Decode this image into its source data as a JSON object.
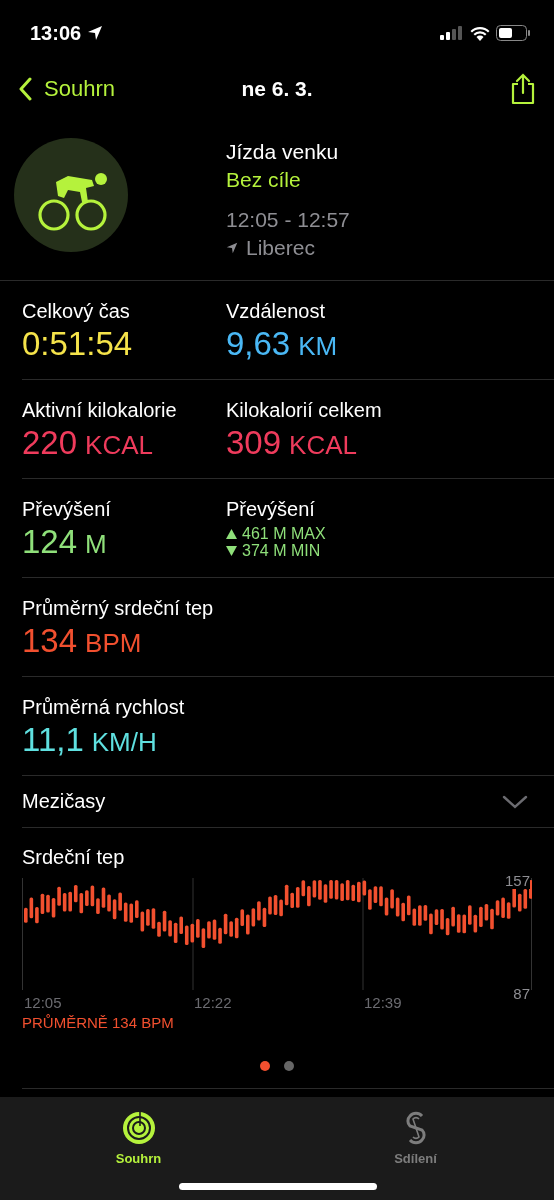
{
  "status_bar": {
    "time": "13:06"
  },
  "nav": {
    "back": "Souhrn",
    "title": "ne 6. 3."
  },
  "workout": {
    "name": "Jízda venku",
    "goal": "Bez cíle",
    "time_range": "12:05 - 12:57",
    "location": "Liberec"
  },
  "metric_rows": [
    {
      "cells": [
        {
          "kind": "value",
          "label": "Celkový čas",
          "value": "0:51:54",
          "color": "#f5e34a"
        },
        {
          "kind": "value",
          "label": "Vzdálenost",
          "value": "9,63",
          "unit": "KM",
          "color": "#4ab8f5"
        }
      ]
    },
    {
      "cells": [
        {
          "kind": "value",
          "label": "Aktivní kilokalorie",
          "value": "220",
          "unit": "KCAL",
          "color": "#ef3b5c"
        },
        {
          "kind": "value",
          "label": "Kilokalorií celkem",
          "value": "309",
          "unit": "KCAL",
          "color": "#ef3b5c"
        }
      ]
    },
    {
      "cells": [
        {
          "kind": "value",
          "label": "Převýšení",
          "value": "124",
          "unit": "M",
          "color": "#8fe07a"
        },
        {
          "kind": "range",
          "label": "Převýšení",
          "max": "461 M MAX",
          "min": "374 M MIN",
          "color": "#8fe07a"
        }
      ]
    },
    {
      "cells": [
        {
          "kind": "value",
          "label": "Průměrný srdeční tep",
          "value": "134",
          "unit": "BPM",
          "color": "#f2502f"
        }
      ]
    },
    {
      "cells": [
        {
          "kind": "value",
          "label": "Průměrná rychlost",
          "value": "11,1",
          "unit": "KM/H",
          "color": "#5fe0e0"
        }
      ]
    }
  ],
  "splits": {
    "label": "Mezičasy",
    "expanded": false
  },
  "heart_rate": {
    "title": "Srdeční tep",
    "y_max_label": "157",
    "y_min_label": "87",
    "x_labels": [
      "12:05",
      "12:22",
      "12:39"
    ],
    "average": "PRŮMĚRNĚ 134 BPM"
  },
  "page_dots": [
    {
      "selected": true
    },
    {
      "selected": false
    }
  ],
  "tabs": [
    {
      "label": "Souhrn",
      "selected": true
    },
    {
      "label": "Sdílení",
      "selected": false
    }
  ]
}
